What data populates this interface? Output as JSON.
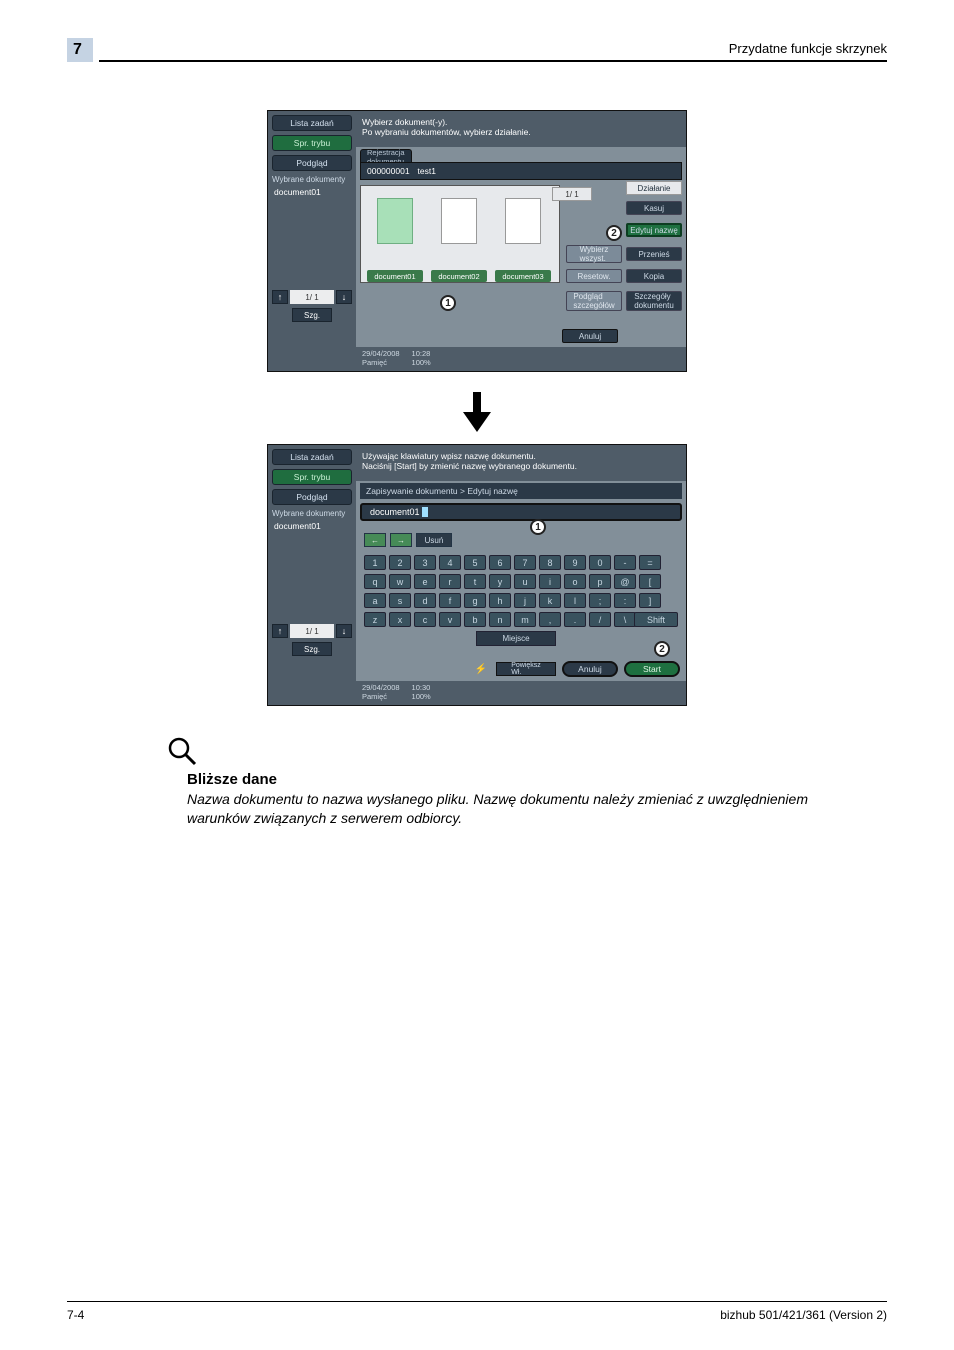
{
  "header": {
    "chapter_num": "7",
    "running_title": "Przydatne funkcje skrzynek"
  },
  "footer": {
    "page": "7-4",
    "product": "bizhub 501/421/361 (Version 2)"
  },
  "screen1": {
    "left_tabs": {
      "lista": "Lista zadań",
      "spr": "Spr. trybu",
      "podglad": "Podgląd"
    },
    "wybrane_label": "Wybrane dokumenty",
    "selected_doc": "document01",
    "page_indicator": "1/  1",
    "szg": "Szg.",
    "top_msg_line1": "Wybierz dokument(-y).",
    "top_msg_line2": "Po wybraniu dokumentów, wybierz działanie.",
    "rtab": "Rejestracja\ndokumentu",
    "subhdr_id": "000000001",
    "subhdr_name": "test1",
    "docs": [
      "document01",
      "document02",
      "document03"
    ],
    "doc_page": "1/  1",
    "action_header": "Działanie",
    "actions": {
      "kasuj": "Kasuj",
      "edytuj": "Edytuj nazwę",
      "wybierz": "Wybierz\nwszyst.",
      "przenies": "Przenieś",
      "resetow": "Resetow.",
      "kopia": "Kopia",
      "podglad": "Podgląd\nszczegółów",
      "szczegoly": "Szczegóły\ndokumentu"
    },
    "anuluj": "Anuluj",
    "status_date": "29/04/2008",
    "status_time": "10:28",
    "status_mem": "Pamięć",
    "status_pct": "100%"
  },
  "screen2": {
    "top_msg_line1": "Używając klawiatury wpisz nazwę dokumentu.",
    "top_msg_line2": "Naciśnij [Start] by zmienić nazwę wybranego dokumentu.",
    "breadcrumb": "Zapisywanie dokumentu > Edytuj nazwę",
    "input_value": "document01",
    "controls": {
      "left": "←",
      "right": "→",
      "usun": "Usuń"
    },
    "rows": [
      [
        "1",
        "2",
        "3",
        "4",
        "5",
        "6",
        "7",
        "8",
        "9",
        "0",
        "-",
        "="
      ],
      [
        "q",
        "w",
        "e",
        "r",
        "t",
        "y",
        "u",
        "i",
        "o",
        "p",
        "@",
        "["
      ],
      [
        "a",
        "s",
        "d",
        "f",
        "g",
        "h",
        "j",
        "k",
        "l",
        ";",
        ":",
        "]"
      ],
      [
        "z",
        "x",
        "c",
        "v",
        "b",
        "n",
        "m",
        ",",
        ".",
        "/",
        "\\"
      ]
    ],
    "shift": "Shift",
    "miejsce": "Miejsce",
    "powieksz": "Powiększ\nWł.",
    "anuluj": "Anuluj",
    "start": "Start",
    "status_date": "29/04/2008",
    "status_time": "10:30",
    "status_mem": "Pamięć",
    "status_pct": "100%"
  },
  "note": {
    "heading": "Bliższe dane",
    "body": "Nazwa dokumentu to nazwa wysłanego pliku. Nazwę dokumentu należy zmieniać z uwzględnieniem warunków związanych z serwerem odbiorcy."
  }
}
